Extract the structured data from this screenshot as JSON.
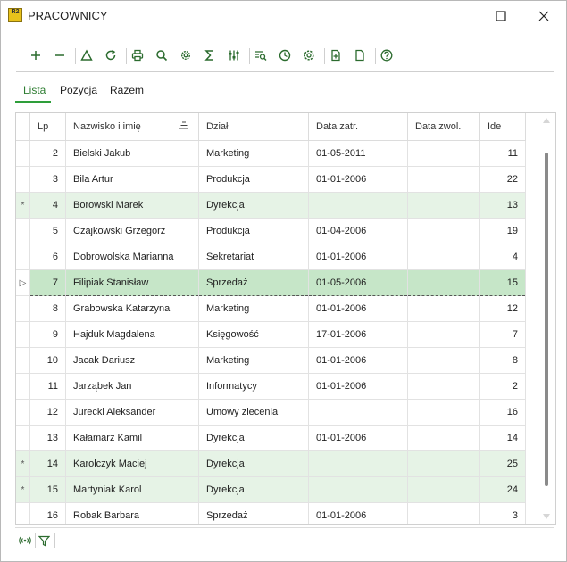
{
  "app": {
    "logo_text": "R2",
    "title": "PRACOWNICY"
  },
  "window_controls": [
    "maximize-icon",
    "close-icon"
  ],
  "toolbar": {
    "buttons": [
      "add-icon",
      "remove-icon",
      "triangle-icon",
      "refresh-icon",
      "print-icon",
      "search-icon",
      "settings-icon",
      "sum-icon",
      "sliders-icon",
      "list-search-icon",
      "clock-icon",
      "gear-cog-icon",
      "new-document-icon",
      "document-icon",
      "help-icon"
    ]
  },
  "tabs": [
    {
      "label": "Lista",
      "active": true
    },
    {
      "label": "Pozycja",
      "active": false
    },
    {
      "label": "Razem",
      "active": false
    }
  ],
  "grid": {
    "columns": [
      "Lp",
      "Nazwisko i imię",
      "Dział",
      "Data zatr.",
      "Data zwol.",
      "Ide"
    ],
    "sorted_column": "Nazwisko i imię",
    "rows": [
      {
        "marker": "",
        "lp": "2",
        "name": "Bielski Jakub",
        "dept": "Marketing",
        "hired": "01-05-2011",
        "fired": "",
        "id": "11",
        "state": "normal"
      },
      {
        "marker": "",
        "lp": "3",
        "name": "Bila Artur",
        "dept": "Produkcja",
        "hired": "01-01-2006",
        "fired": "",
        "id": "22",
        "state": "normal"
      },
      {
        "marker": "*",
        "lp": "4",
        "name": "Borowski Marek",
        "dept": "Dyrekcja",
        "hired": "",
        "fired": "",
        "id": "13",
        "state": "modified"
      },
      {
        "marker": "",
        "lp": "5",
        "name": "Czajkowski Grzegorz",
        "dept": "Produkcja",
        "hired": "01-04-2006",
        "fired": "",
        "id": "19",
        "state": "normal"
      },
      {
        "marker": "",
        "lp": "6",
        "name": "Dobrowolska Marianna",
        "dept": "Sekretariat",
        "hired": "01-01-2006",
        "fired": "",
        "id": "4",
        "state": "normal"
      },
      {
        "marker": "▷",
        "lp": "7",
        "name": "Filipiak Stanisław",
        "dept": "Sprzedaż",
        "hired": "01-05-2006",
        "fired": "",
        "id": "15",
        "state": "selected"
      },
      {
        "marker": "",
        "lp": "8",
        "name": "Grabowska Katarzyna",
        "dept": "Marketing",
        "hired": "01-01-2006",
        "fired": "",
        "id": "12",
        "state": "normal"
      },
      {
        "marker": "",
        "lp": "9",
        "name": "Hajduk Magdalena",
        "dept": "Księgowość",
        "hired": "17-01-2006",
        "fired": "",
        "id": "7",
        "state": "normal"
      },
      {
        "marker": "",
        "lp": "10",
        "name": "Jacak Dariusz",
        "dept": "Marketing",
        "hired": "01-01-2006",
        "fired": "",
        "id": "8",
        "state": "normal"
      },
      {
        "marker": "",
        "lp": "11",
        "name": "Jarząbek Jan",
        "dept": "Informatycy",
        "hired": "01-01-2006",
        "fired": "",
        "id": "2",
        "state": "normal"
      },
      {
        "marker": "",
        "lp": "12",
        "name": "Jurecki Aleksander",
        "dept": "Umowy zlecenia",
        "hired": "",
        "fired": "",
        "id": "16",
        "state": "normal"
      },
      {
        "marker": "",
        "lp": "13",
        "name": "Kałamarz Kamil",
        "dept": "Dyrekcja",
        "hired": "01-01-2006",
        "fired": "",
        "id": "14",
        "state": "normal"
      },
      {
        "marker": "*",
        "lp": "14",
        "name": "Karolczyk Maciej",
        "dept": "Dyrekcja",
        "hired": "",
        "fired": "",
        "id": "25",
        "state": "modified"
      },
      {
        "marker": "*",
        "lp": "15",
        "name": "Martyniak Karol",
        "dept": "Dyrekcja",
        "hired": "",
        "fired": "",
        "id": "24",
        "state": "modified"
      },
      {
        "marker": "",
        "lp": "16",
        "name": "Robak Barbara",
        "dept": "Sprzedaż",
        "hired": "01-01-2006",
        "fired": "",
        "id": "3",
        "state": "normal"
      }
    ]
  },
  "statusbar": {
    "buttons": [
      "broadcast-icon",
      "filter-icon"
    ]
  },
  "colors": {
    "accent": "#2e7d32",
    "modified_row": "#e6f3e6",
    "selected_row": "#c6e6c8"
  }
}
